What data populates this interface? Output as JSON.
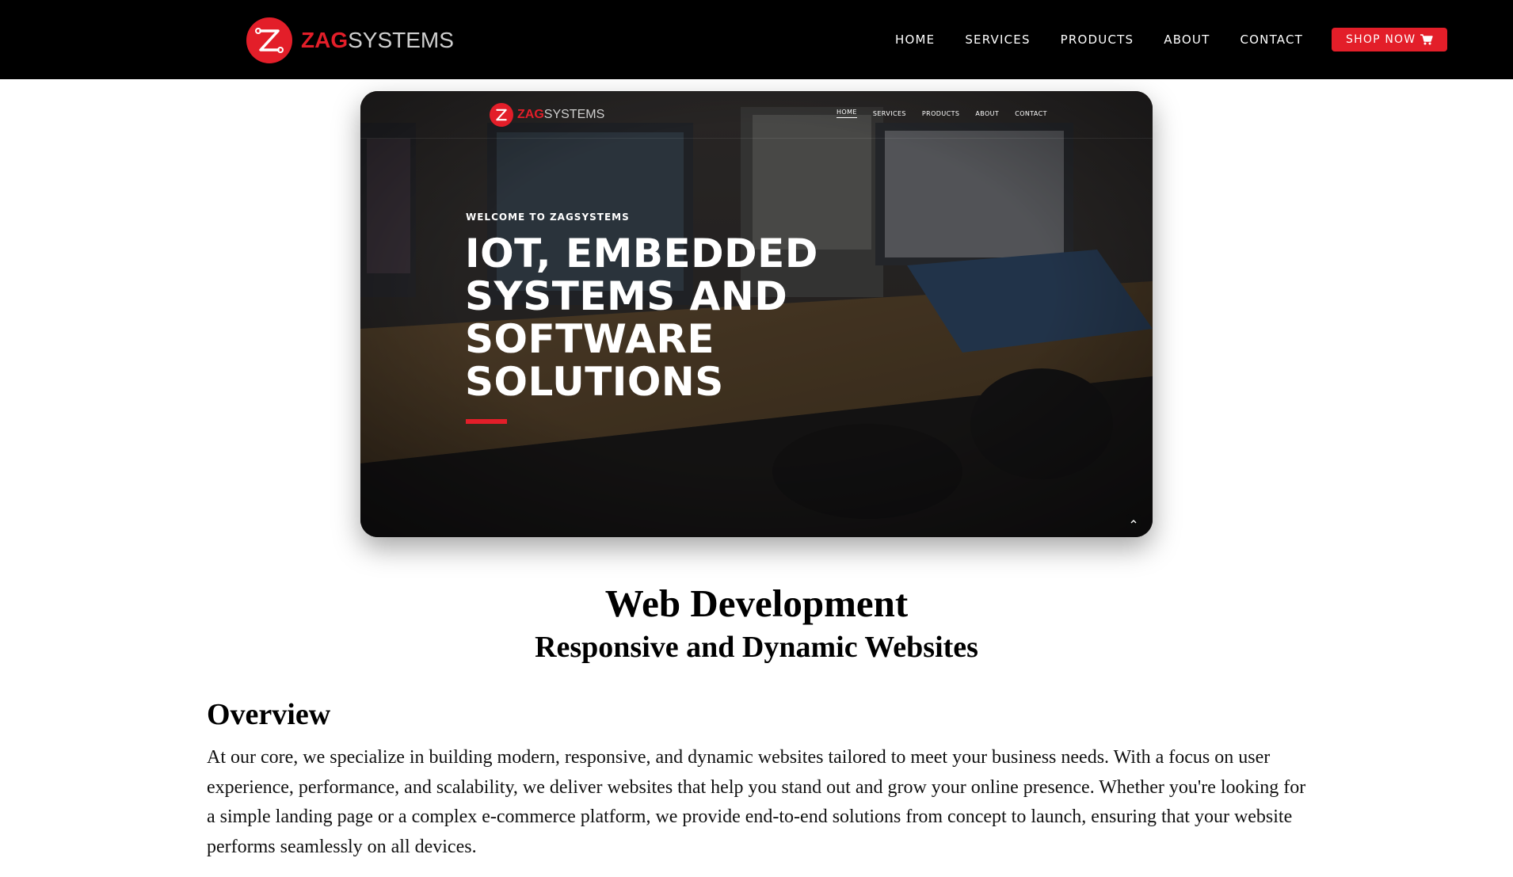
{
  "header": {
    "brand": {
      "zag": "ZAG",
      "systems": "SYSTEMS"
    },
    "nav": [
      {
        "label": "HOME"
      },
      {
        "label": "SERVICES"
      },
      {
        "label": "PRODUCTS"
      },
      {
        "label": "ABOUT"
      },
      {
        "label": "CONTACT"
      }
    ],
    "shop_button": {
      "label": "SHOP NOW",
      "icon": "cart-icon"
    }
  },
  "hero_preview": {
    "brand": {
      "zag": "ZAG",
      "systems": "SYSTEMS"
    },
    "nav": [
      {
        "label": "HOME"
      },
      {
        "label": "SERVICES"
      },
      {
        "label": "PRODUCTS"
      },
      {
        "label": "ABOUT"
      },
      {
        "label": "CONTACT"
      }
    ],
    "kicker": "WELCOME TO ZAGSYSTEMS",
    "title": "IOT, EMBEDDED SYSTEMS AND SOFTWARE SOLUTIONS",
    "scroll_icon": "chevron-up-icon"
  },
  "content": {
    "title": "Web Development",
    "subtitle": "Responsive and Dynamic Websites",
    "overview_heading": "Overview",
    "overview_text": "At our core, we specialize in building modern, responsive, and dynamic websites tailored to meet your business needs. With a focus on user experience, performance, and scalability, we deliver websites that help you stand out and grow your online presence. Whether you're looking for a simple landing page or a complex e-commerce platform, we provide end-to-end solutions from concept to launch, ensuring that your website performs seamlessly on all devices."
  },
  "colors": {
    "accent": "#e31e29",
    "header_bg": "#000000",
    "page_bg": "#ffffff"
  }
}
